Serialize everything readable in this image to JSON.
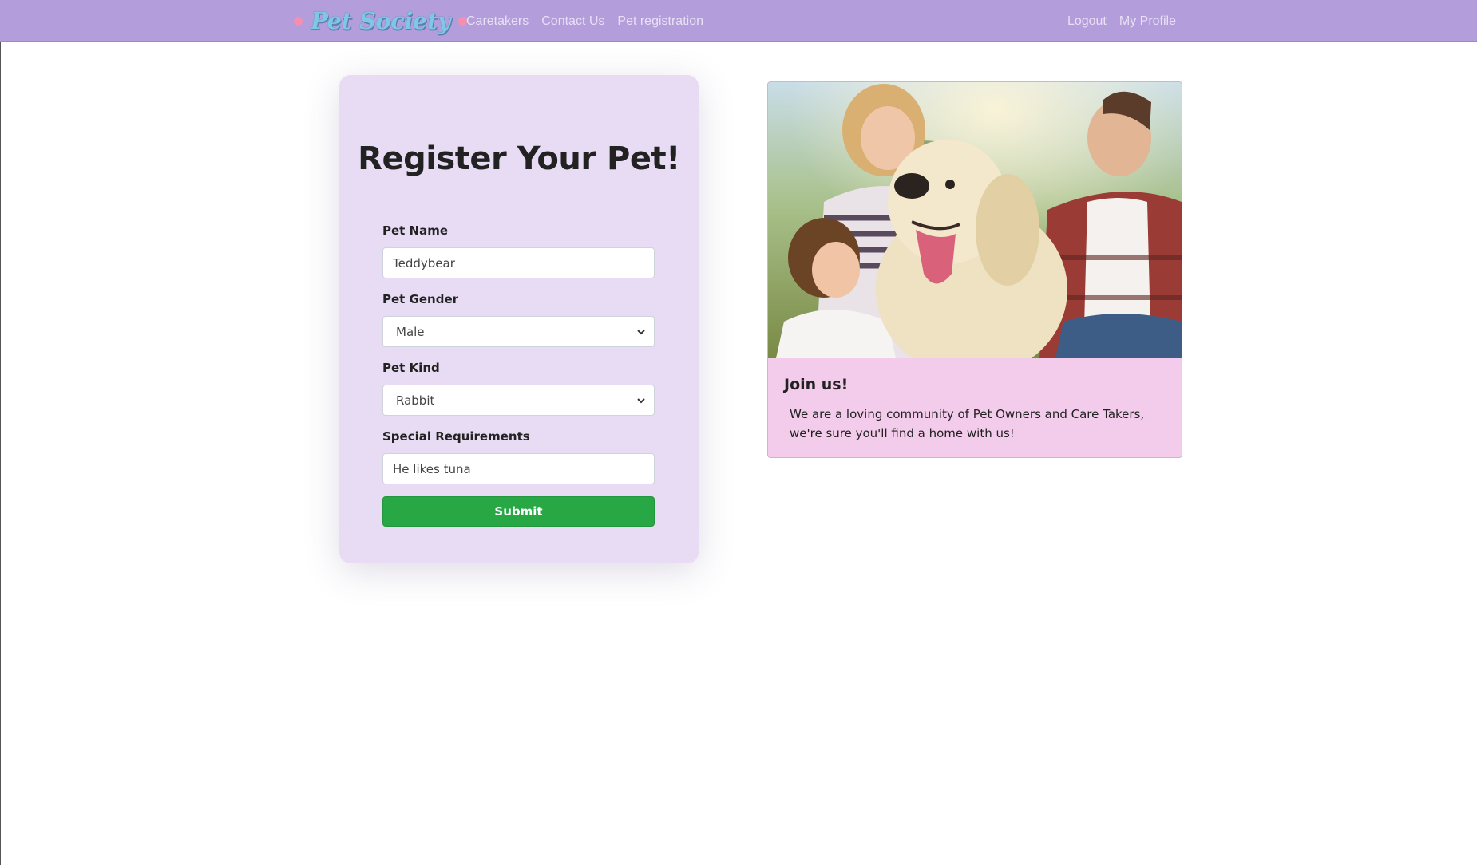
{
  "navbar": {
    "brand": "Pet Society",
    "links_left": [
      "Caretakers",
      "Contact Us",
      "Pet registration"
    ],
    "links_right": [
      "Logout",
      "My Profile"
    ]
  },
  "form": {
    "title": "Register Your Pet!",
    "pet_name_label": "Pet Name",
    "pet_name_value": "Teddybear",
    "pet_gender_label": "Pet Gender",
    "pet_gender_value": "Male",
    "pet_kind_label": "Pet Kind",
    "pet_kind_value": "Rabbit",
    "special_label": "Special Requirements",
    "special_value": "He likes tuna",
    "submit_label": "Submit"
  },
  "info": {
    "title": "Join us!",
    "text": "We are a loving community of Pet Owners and Care Takers, we're sure you'll find a home with us!"
  },
  "colors": {
    "navbar": "#b39ddb",
    "form_card": "#e8dcf5",
    "info_card": "#f3cbeb",
    "submit": "#28a745"
  }
}
